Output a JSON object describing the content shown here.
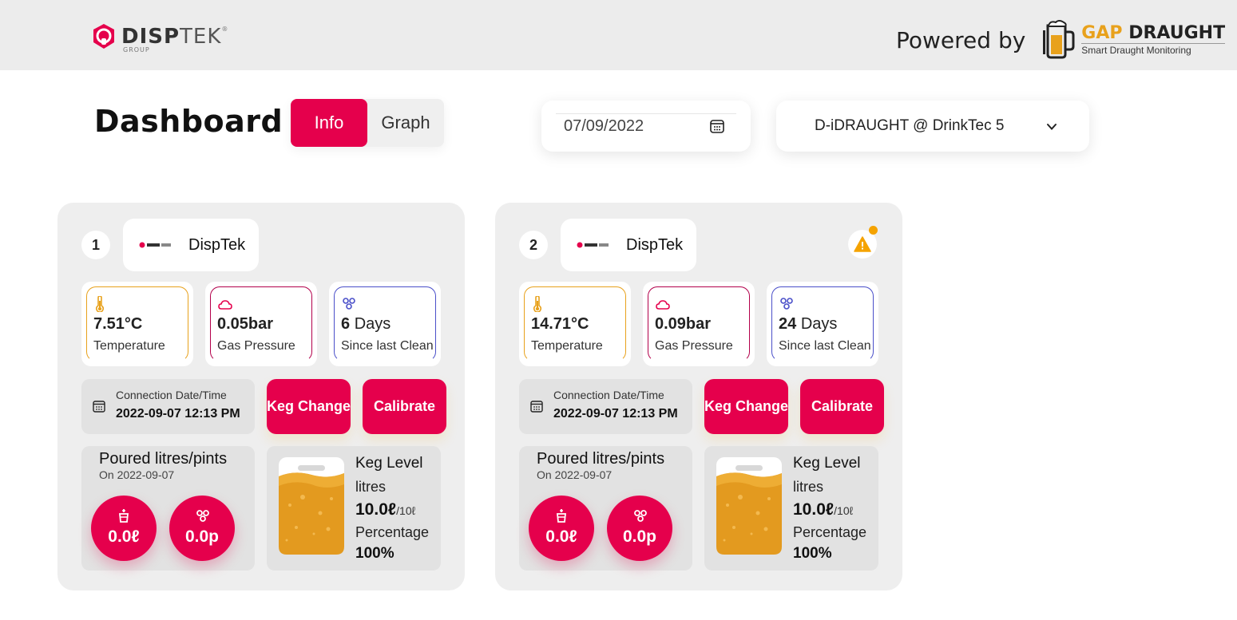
{
  "header": {
    "brand_bold": "DISP",
    "brand_light": "TEK",
    "brand_sub": "GROUP",
    "brand_reg": "®",
    "powered_by": "Powered by",
    "partner_title_1": "GAP",
    "partner_title_2": "DRAUGHT",
    "partner_subtitle": "Smart Draught Monitoring"
  },
  "toolbar": {
    "page_title": "Dashboard",
    "view_tabs": [
      "Info",
      "Graph"
    ],
    "active_tab": "Info",
    "date_value": "07/09/2022",
    "device_selected": "D-iDRAUGHT @ DrinkTec 5"
  },
  "colors": {
    "accent": "#e5004c",
    "temperature": "#e8a11c",
    "gas": "#b3004b",
    "clean": "#4a4fc9",
    "alert": "#f5a300",
    "beer": "#e39a1f"
  },
  "taps": [
    {
      "number": "1",
      "brand": "DispTek",
      "temperature_value": "7.51°C",
      "temperature_label": "Temperature",
      "gas_value": "0.05bar",
      "gas_label": "Gas Pressure",
      "clean_days": "6",
      "clean_unit": "Days",
      "clean_label": "Since last Clean",
      "connection_label": "Connection Date/Time",
      "connection_value": "2022-09-07 12:13 PM",
      "keg_change_label": "Keg Change",
      "calibrate_label": "Calibrate",
      "poured_title": "Poured litres/pints",
      "poured_date": "On 2022-09-07",
      "poured_litres": "0.0ℓ",
      "poured_pints": "0.0p",
      "keg_title": "Keg Level",
      "keg_unit": "litres",
      "keg_litres": "10.0ℓ",
      "keg_capacity": "/10ℓ",
      "keg_pct_label": "Percentage",
      "keg_pct": "100%",
      "keg_fraction": 1.0,
      "has_alert": false
    },
    {
      "number": "2",
      "brand": "DispTek",
      "temperature_value": "14.71°C",
      "temperature_label": "Temperature",
      "gas_value": "0.09bar",
      "gas_label": "Gas Pressure",
      "clean_days": "24",
      "clean_unit": "Days",
      "clean_label": "Since last Clean",
      "connection_label": "Connection Date/Time",
      "connection_value": "2022-09-07 12:13 PM",
      "keg_change_label": "Keg Change",
      "calibrate_label": "Calibrate",
      "poured_title": "Poured litres/pints",
      "poured_date": "On 2022-09-07",
      "poured_litres": "0.0ℓ",
      "poured_pints": "0.0p",
      "keg_title": "Keg Level",
      "keg_unit": "litres",
      "keg_litres": "10.0ℓ",
      "keg_capacity": "/10ℓ",
      "keg_pct_label": "Percentage",
      "keg_pct": "100%",
      "keg_fraction": 1.0,
      "has_alert": true
    }
  ]
}
